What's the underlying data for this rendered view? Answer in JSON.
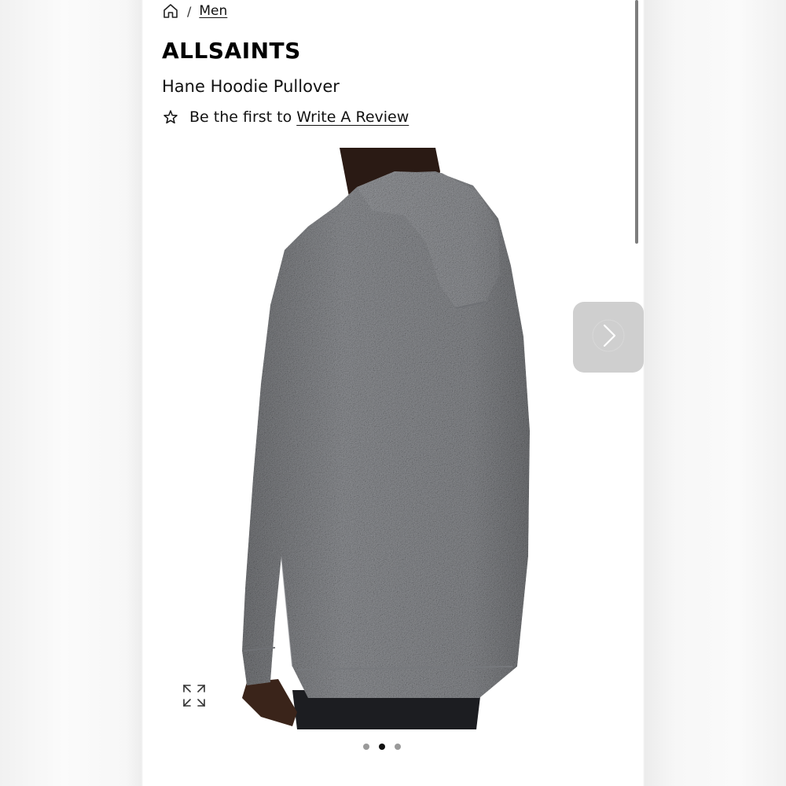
{
  "breadcrumb": {
    "home_icon": "home-icon",
    "separator": "/",
    "current": "Men"
  },
  "product": {
    "brand": "ALLSAINTS",
    "name": "Hane Hoodie Pullover"
  },
  "review": {
    "icon": "star-outline-icon",
    "prompt": "Be the first to",
    "link_label": "Write A Review"
  },
  "gallery": {
    "image_subject": "grey marl knit hoodie, back view",
    "expand_icon": "expand-icon",
    "next_icon": "chevron-right-icon",
    "slide_count": 3,
    "active_slide": 2
  },
  "colors": {
    "text": "#111111",
    "sweater": "#8e9094",
    "next_button_bg": "#cfcfcf"
  }
}
